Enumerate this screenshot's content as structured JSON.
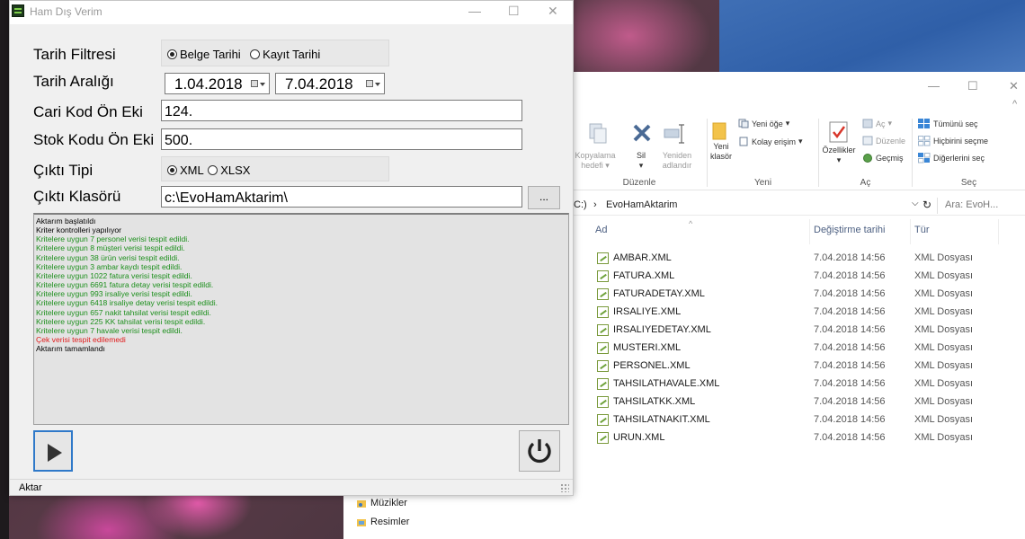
{
  "dialog": {
    "title": "Ham Dış Verim",
    "minimize": "—",
    "maximize": "☐",
    "close": "✕",
    "date_filter_label": "Tarih Filtresi",
    "date_filter_options": [
      {
        "label": "Belge Tarihi",
        "selected": true
      },
      {
        "label": "Kayıt Tarihi",
        "selected": false
      }
    ],
    "date_range_label": "Tarih Aralığı",
    "date_from": "1.04.2018",
    "date_to": "7.04.2018",
    "cari_prefix_label": "Cari Kod Ön Eki",
    "cari_prefix_value": "124.",
    "stok_prefix_label": "Stok Kodu Ön Eki",
    "stok_prefix_value": "500.",
    "output_type_label": "Çıktı Tipi",
    "output_type_options": [
      {
        "label": "XML",
        "selected": true
      },
      {
        "label": "XLSX",
        "selected": false
      }
    ],
    "output_folder_label": "Çıktı Klasörü",
    "output_folder_value": "c:\\EvoHamAktarim\\",
    "browse_label": "...",
    "status": "Aktar"
  },
  "log": [
    {
      "text": "Aktarım başlatıldı",
      "color": "black"
    },
    {
      "text": "Kriter kontrolleri yapılıyor",
      "color": "black"
    },
    {
      "text": "Kritelere uygun 7 personel verisi tespit edildi.",
      "color": "green"
    },
    {
      "text": "Kritelere uygun 8 müşteri verisi tespit edildi.",
      "color": "green"
    },
    {
      "text": "Kritelere uygun 38 ürün verisi tespit edildi.",
      "color": "green"
    },
    {
      "text": "Kritelere uygun 3 ambar kaydı tespit edildi.",
      "color": "green"
    },
    {
      "text": "Kritelere uygun 1022 fatura verisi tespit edildi.",
      "color": "green"
    },
    {
      "text": "Kritelere uygun 6691 fatura detay verisi tespit edildi.",
      "color": "green"
    },
    {
      "text": "Kritelere uygun 993 irsaliye verisi tespit edildi.",
      "color": "green"
    },
    {
      "text": "Kritelere uygun 6418 irsaliye detay verisi tespit edildi.",
      "color": "green"
    },
    {
      "text": "Kritelere uygun 657 nakit tahsilat verisi tespit edildi.",
      "color": "green"
    },
    {
      "text": "Kritelere uygun 225 KK tahsilat verisi tespit edildi.",
      "color": "green"
    },
    {
      "text": "Kritelere uygun 7 havale verisi tespit edildi.",
      "color": "green"
    },
    {
      "text": "Çek verisi tespit edilemedi",
      "color": "red"
    },
    {
      "text": "Aktarım tamamlandı",
      "color": "black"
    }
  ],
  "explorer": {
    "window_buttons": {
      "minimize": "—",
      "maximize": "☐",
      "close": "✕",
      "collapse": "^"
    },
    "ribbon": {
      "copy_path_line1": "Kopyalama",
      "copy_path_line2": "hedefi",
      "delete": "Sil",
      "rename_line1": "Yeniden",
      "rename_line2": "adlandır",
      "new_folder_line1": "Yeni",
      "new_folder_line2": "klasör",
      "new_item": "Yeni öğe",
      "easy_access": "Kolay erişim",
      "properties": "Özellikler",
      "open": "Aç",
      "edit": "Düzenle",
      "history": "Geçmiş",
      "select_all": "Tümünü seç",
      "select_none": "Hiçbirini seçme",
      "invert_selection": "Diğerlerini seç",
      "group_arrange": "Düzenle",
      "group_new": "Yeni",
      "group_open": "Aç",
      "group_select": "Seç"
    },
    "address": {
      "drive": "C:)",
      "sep": "›",
      "folder": "EvoHamAktarim",
      "search_placeholder": "Ara: EvoH..."
    },
    "columns": {
      "name": "Ad",
      "date": "Değiştirme tarihi",
      "type": "Tür"
    },
    "files": [
      {
        "name": "AMBAR.XML",
        "date": "7.04.2018 14:56",
        "type": "XML Dosyası"
      },
      {
        "name": "FATURA.XML",
        "date": "7.04.2018 14:56",
        "type": "XML Dosyası"
      },
      {
        "name": "FATURADETAY.XML",
        "date": "7.04.2018 14:56",
        "type": "XML Dosyası"
      },
      {
        "name": "IRSALIYE.XML",
        "date": "7.04.2018 14:56",
        "type": "XML Dosyası"
      },
      {
        "name": "IRSALIYEDETAY.XML",
        "date": "7.04.2018 14:56",
        "type": "XML Dosyası"
      },
      {
        "name": "MUSTERI.XML",
        "date": "7.04.2018 14:56",
        "type": "XML Dosyası"
      },
      {
        "name": "PERSONEL.XML",
        "date": "7.04.2018 14:56",
        "type": "XML Dosyası"
      },
      {
        "name": "TAHSILATHAVALE.XML",
        "date": "7.04.2018 14:56",
        "type": "XML Dosyası"
      },
      {
        "name": "TAHSILATKK.XML",
        "date": "7.04.2018 14:56",
        "type": "XML Dosyası"
      },
      {
        "name": "TAHSILATNAKIT.XML",
        "date": "7.04.2018 14:56",
        "type": "XML Dosyası"
      },
      {
        "name": "URUN.XML",
        "date": "7.04.2018 14:56",
        "type": "XML Dosyası"
      }
    ],
    "nav": [
      {
        "label": "Müzikler",
        "icon": "music-folder-icon"
      },
      {
        "label": "Resimler",
        "icon": "pictures-folder-icon"
      }
    ]
  },
  "colors": {
    "log_green": "#1c8f1c",
    "log_red": "#e01b1b",
    "accent_blue": "#2f79c9"
  }
}
